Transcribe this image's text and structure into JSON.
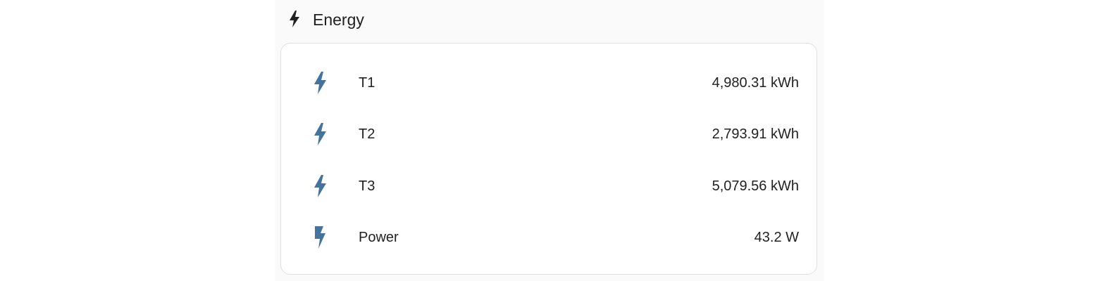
{
  "card": {
    "title": "Energy",
    "icon": "flash-icon"
  },
  "colors": {
    "icon_blue": "#44739e",
    "text": "#212121",
    "panel_bg": "#fafafa",
    "card_bg": "#ffffff",
    "border": "#e0e0e0"
  },
  "entities": [
    {
      "name": "T1",
      "value": "4,980.31 kWh",
      "icon": "flash-icon"
    },
    {
      "name": "T2",
      "value": "2,793.91 kWh",
      "icon": "flash-icon"
    },
    {
      "name": "T3",
      "value": "5,079.56 kWh",
      "icon": "flash-icon"
    },
    {
      "name": "Power",
      "value": "43.2 W",
      "icon": "lightning-bolt-icon"
    }
  ]
}
